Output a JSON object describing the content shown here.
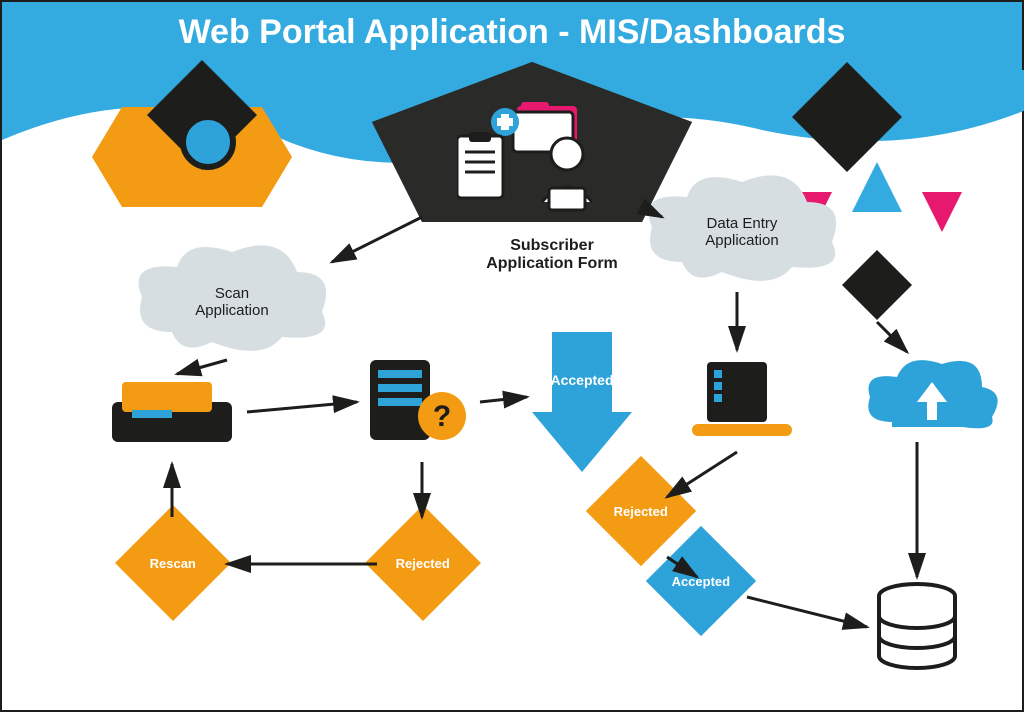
{
  "title": "Web Portal Application - MIS/Dashboards",
  "nodes": {
    "scan_app": "Scan\nApplication",
    "data_entry_app": "Data Entry\nApplication",
    "subscriber_app_form": "Subscriber\nApplication Form",
    "accepted": "Accepted",
    "rejected": "Rejected",
    "rescan": "Rescan"
  },
  "colors": {
    "header": "#34abe0",
    "orange": "#f39b13",
    "blue": "#2ea3d9",
    "pink": "#e6196e",
    "dark": "#1d1d1b",
    "cloud": "#d7dee2"
  }
}
